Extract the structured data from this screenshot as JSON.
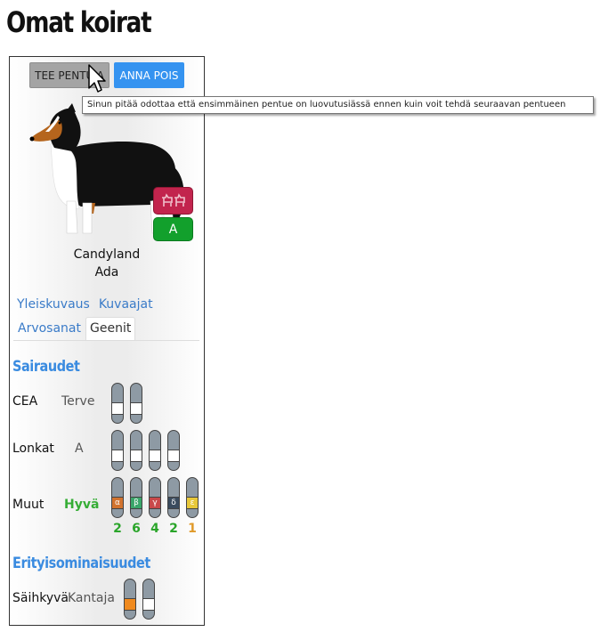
{
  "page": {
    "title": "Omat koirat"
  },
  "toolbar": {
    "breed_label": "TEE PENTUJA",
    "give_label": "ANNA POIS"
  },
  "tooltip": {
    "text": "Sinun pitää odottaa että ensimmäinen pentue on luovutusiässä ennen kuin voit tehdä seuraavan pentueen"
  },
  "dog": {
    "kennel": "Candyland",
    "name": "Ada",
    "grade_badge": "A"
  },
  "tabs": [
    {
      "label": "Yleiskuvaus",
      "active": false
    },
    {
      "label": "Kuvaajat",
      "active": false
    },
    {
      "label": "Arvosanat",
      "active": false
    },
    {
      "label": "Geenit",
      "active": true
    }
  ],
  "diseases": {
    "title": "Sairaudet",
    "cea": {
      "label": "CEA",
      "value": "Terve"
    },
    "hips": {
      "label": "Lonkat",
      "value": "A"
    },
    "other": {
      "label": "Muut",
      "value": "Hyvä",
      "genes": [
        {
          "symbol": "α",
          "color": "#d2732e",
          "count": "2",
          "count_color": "#2aa52a"
        },
        {
          "symbol": "β",
          "color": "#3aa66a",
          "count": "6",
          "count_color": "#2aa52a"
        },
        {
          "symbol": "γ",
          "color": "#c8484a",
          "count": "4",
          "count_color": "#2aa52a"
        },
        {
          "symbol": "δ",
          "color": "#3a4b5e",
          "count": "2",
          "count_color": "#2aa52a"
        },
        {
          "symbol": "ε",
          "color": "#e8c83a",
          "count": "1",
          "count_color": "#e09a2a"
        }
      ]
    }
  },
  "special": {
    "title": "Erityisominaisuudet",
    "merle": {
      "label": "Säihkyvä",
      "value": "Kantaja"
    }
  },
  "colors": {
    "accent": "#3a8be0",
    "give_button": "#3593f0",
    "breed_badge": "#c2244d",
    "grade_badge": "#12a02c",
    "merle_allele": "#f08a1e"
  }
}
